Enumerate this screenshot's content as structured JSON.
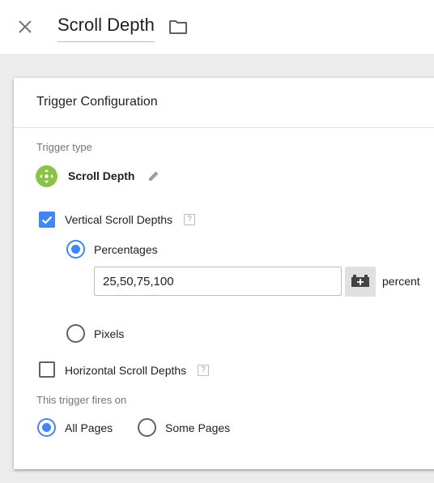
{
  "header": {
    "title": "Scroll Depth",
    "close_icon": "close-icon",
    "folder_icon": "folder-icon"
  },
  "card": {
    "title": "Trigger Configuration",
    "trigger_type_label": "Trigger type",
    "trigger_type": {
      "name": "Scroll Depth",
      "icon": "scroll-depth-icon",
      "icon_color": "#8bc34a",
      "edit_icon": "pencil-icon"
    },
    "vertical": {
      "label": "Vertical Scroll Depths",
      "checked": true,
      "help": "?",
      "percentages_label": "Percentages",
      "percentages_selected": true,
      "percentages_value": "25,50,75,100",
      "variable_icon": "variable-picker-icon",
      "unit": "percent",
      "pixels_label": "Pixels",
      "pixels_selected": false
    },
    "horizontal": {
      "label": "Horizontal Scroll Depths",
      "checked": false,
      "help": "?"
    },
    "fires_on": {
      "label": "This trigger fires on",
      "options": [
        {
          "label": "All Pages",
          "selected": true
        },
        {
          "label": "Some Pages",
          "selected": false
        }
      ]
    }
  },
  "colors": {
    "accent": "#4285f4",
    "trigger_icon": "#8bc34a",
    "background": "#ececec"
  }
}
